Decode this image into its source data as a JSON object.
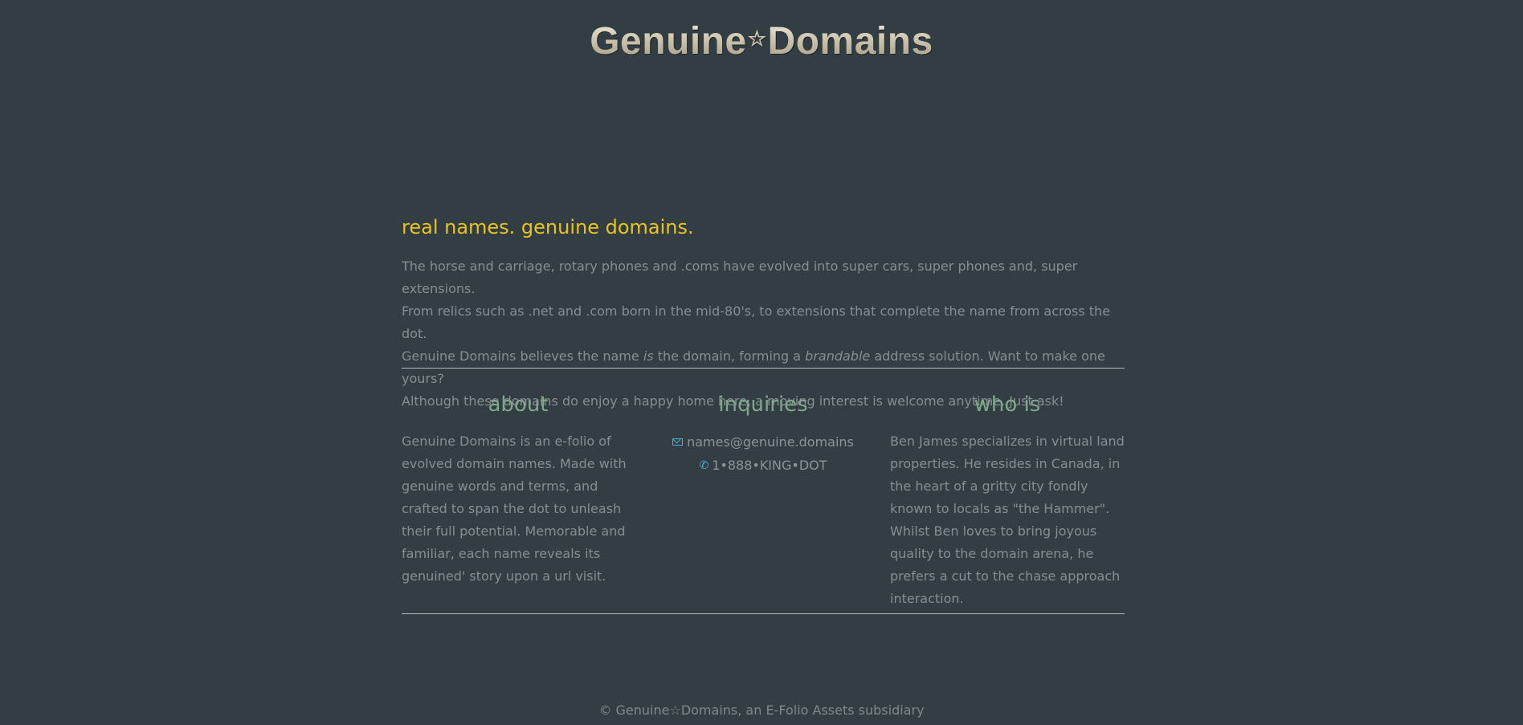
{
  "header": {
    "logo_left": "Genuine",
    "logo_star": "☆",
    "logo_right": "Domains"
  },
  "main": {
    "tagline": "real names. genuine domains.",
    "intro": {
      "line1": "The horse and carriage, rotary phones and .coms have evolved into super cars, super phones and, super extensions.",
      "line2": "From relics such as .net and .com born in the mid-80's, to extensions that complete the name from across the dot.",
      "line3_a": "Genuine Domains believes the name ",
      "line3_em1": "is",
      "line3_b": " the domain, forming a ",
      "line3_em2": "brandable",
      "line3_c": " address solution. Want to make one yours?",
      "line4": "Although these domains do enjoy a happy home here, a moving interest is welcome anytime. Just ask!"
    }
  },
  "about": {
    "heading": "about",
    "body": "Genuine Domains is an e-folio of evolved domain names. Made with genuine words and terms, and crafted to span the dot to unleash their full potential.  Memorable and familiar, each name reveals its genuined' story upon a url visit."
  },
  "inquiries": {
    "heading": "inquiries",
    "email": "names@genuine.domains",
    "phone": "1•888•KING•DOT",
    "email_icon": "envelope-icon",
    "phone_icon": "phone-icon",
    "icon_color": "#4bb0d6"
  },
  "whois": {
    "heading": "who is",
    "body": "Ben James specializes in virtual land properties. He resides in Canada, in the heart of a gritty city fondly known to locals as \"the Hammer\". Whilst Ben loves to bring joyous quality to the domain arena, he prefers a cut to the chase approach interaction."
  },
  "footer": {
    "text": "© Genuine☆Domains, an E-Folio Assets subsidiary"
  },
  "colors": {
    "background": "#333e44",
    "tagline": "#e8c41e",
    "heading": "#7fa88a",
    "body_text": "#868e92"
  }
}
